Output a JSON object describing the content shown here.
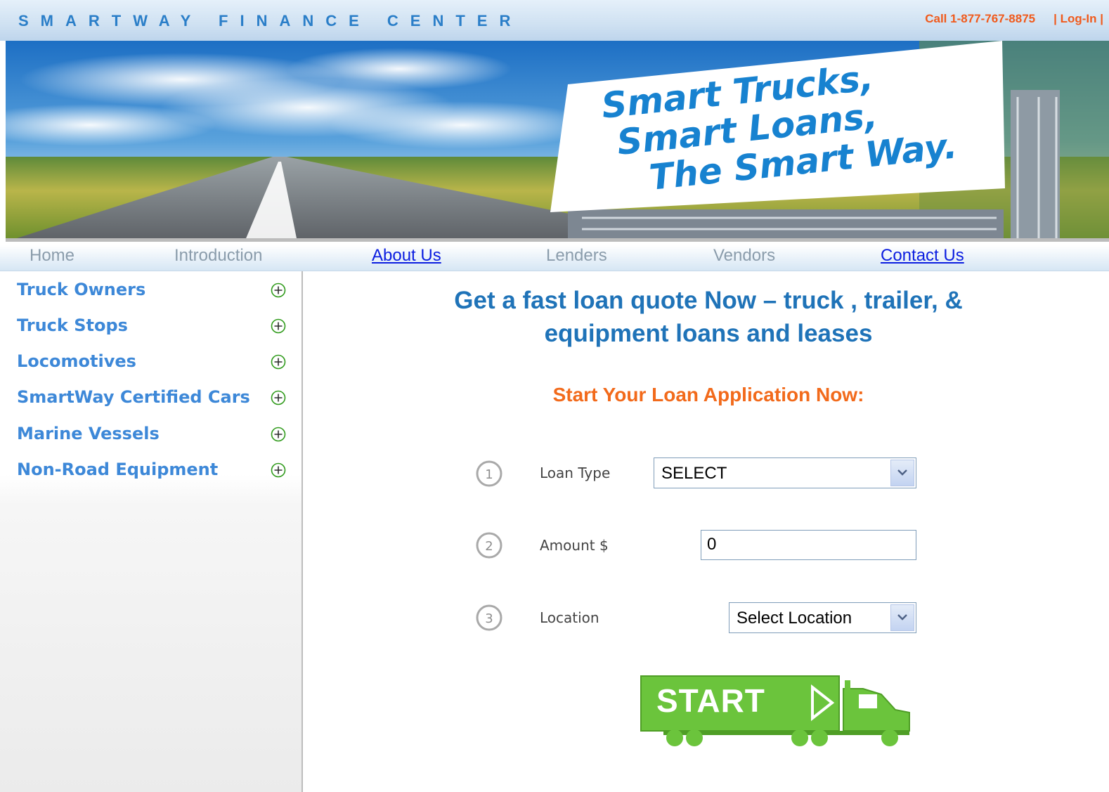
{
  "header": {
    "brand": "SMARTWAY FINANCE CENTER",
    "phone": "Call 1-877-767-8875",
    "login": "| Log-In |"
  },
  "hero": {
    "billboard_lines": [
      "Smart Trucks,",
      "Smart Loans,",
      "The Smart Way."
    ]
  },
  "nav": {
    "items": [
      {
        "label": "Home",
        "link": false
      },
      {
        "label": "Introduction",
        "link": false
      },
      {
        "label": "About Us",
        "link": true
      },
      {
        "label": "Lenders",
        "link": false
      },
      {
        "label": "Vendors",
        "link": false
      },
      {
        "label": "Contact Us",
        "link": true
      }
    ]
  },
  "sidebar": {
    "items": [
      {
        "label": "Truck Owners",
        "icon": "plus-circle-icon"
      },
      {
        "label": "Truck Stops",
        "icon": "plus-circle-icon"
      },
      {
        "label": "Locomotives",
        "icon": "plus-circle-icon"
      },
      {
        "label": "SmartWay Certified Cars",
        "icon": "plus-circle-icon"
      },
      {
        "label": "Marine Vessels",
        "icon": "plus-circle-icon"
      },
      {
        "label": "Non-Road Equipment",
        "icon": "plus-circle-icon"
      }
    ]
  },
  "main": {
    "headline_line1": "Get a fast loan quote Now – truck , trailer, &",
    "headline_line2": "equipment loans and leases",
    "subhead": "Start Your Loan Application Now:",
    "form": {
      "step1_number": "1",
      "step1_label": "Loan Type",
      "loan_type_value": "SELECT",
      "step2_number": "2",
      "step2_label": "Amount $",
      "amount_value": "0",
      "step3_number": "3",
      "step3_label": "Location",
      "location_value": "Select Location"
    },
    "start_label": "START"
  },
  "colors": {
    "brand_blue": "#2a7ec8",
    "accent_orange": "#f26a1b",
    "sidebar_blue": "#3d88d8",
    "plus_green": "#2f9a1a",
    "start_green": "#6bc43c"
  }
}
